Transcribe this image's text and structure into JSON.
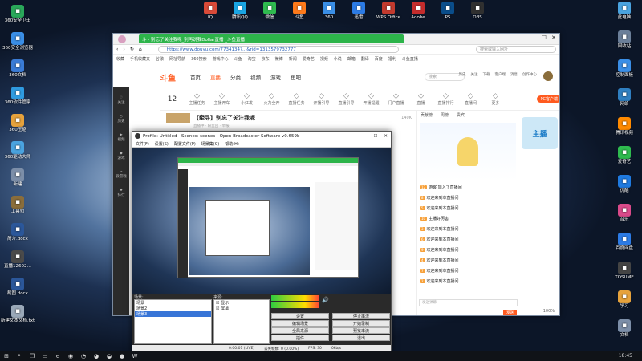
{
  "desktop": {
    "left_icons": [
      {
        "label": "360安全卫士",
        "color": "#2aa85a"
      },
      {
        "label": "360安全浏览器",
        "color": "#3a8ee6"
      },
      {
        "label": "360文档",
        "color": "#3a7bd5"
      },
      {
        "label": "360软件管家",
        "color": "#2f9be0"
      },
      {
        "label": "360压缩",
        "color": "#e6a23c"
      },
      {
        "label": "360驱动大师",
        "color": "#4aa3df"
      },
      {
        "label": "新建",
        "color": "#7c8ea8"
      },
      {
        "label": "工具包",
        "color": "#8a6d3b"
      },
      {
        "label": "简介.docx",
        "color": "#2b579a"
      },
      {
        "label": "直播12602…",
        "color": "#4a4a4a"
      },
      {
        "label": "截图.docx",
        "color": "#2b579a"
      },
      {
        "label": "新建文本文档.txt",
        "color": "#9aa8b8"
      }
    ],
    "top_icons": [
      {
        "label": "IQ",
        "color": "#d94a38"
      },
      {
        "label": "腾讯QQ",
        "color": "#1aa5e3"
      },
      {
        "label": "微信",
        "color": "#2fbb4f"
      },
      {
        "label": "斗鱼",
        "color": "#ff7a1a"
      },
      {
        "label": "360",
        "color": "#3a8ee6"
      },
      {
        "label": "迅雷",
        "color": "#2c7be5"
      },
      {
        "label": "WPS Office",
        "color": "#c23a2e"
      },
      {
        "label": "Adobe",
        "color": "#c42c2c"
      },
      {
        "label": "PS",
        "color": "#0a4d8a"
      },
      {
        "label": "OBS",
        "color": "#303030"
      }
    ],
    "right_icons": [
      {
        "label": "此电脑",
        "color": "#4aa3df"
      },
      {
        "label": "回收站",
        "color": "#6b7f99"
      },
      {
        "label": "控制面板",
        "color": "#3a8ee6"
      },
      {
        "label": "网络",
        "color": "#2f7fc1"
      },
      {
        "label": "腾讯视频",
        "color": "#ff8a00"
      },
      {
        "label": "爱奇艺",
        "color": "#2fbb4f"
      },
      {
        "label": "优酷",
        "color": "#1f7ae0"
      },
      {
        "label": "音乐",
        "color": "#d94a8a"
      },
      {
        "label": "百度网盘",
        "color": "#2c7be5"
      },
      {
        "label": "TOSUME",
        "color": "#444"
      },
      {
        "label": "学习",
        "color": "#e6a23c"
      },
      {
        "label": "文档",
        "color": "#7c8ea8"
      }
    ]
  },
  "browser": {
    "tab_title": "斗 - 别忘了关注我呢_别再说我Dollar直播 _斗鱼直播",
    "url": "https://www.douyu.com/7734134?...&rid=1313579732777",
    "search_placeholder": "搜索或输入网址",
    "bookmarks": [
      "收藏",
      "手机收藏夹",
      "谷歌",
      "网址导航",
      "360搜索",
      "游戏中心",
      "斗鱼",
      "淘宝",
      "京东",
      "微博",
      "新闻",
      "爱奇艺",
      "视频",
      "小说",
      "邮箱",
      "翻译",
      "百度",
      "福利",
      "斗鱼直播"
    ],
    "site": {
      "logo": "斗鱼",
      "nav": [
        "首页",
        "直播",
        "分类",
        "视频",
        "游戏",
        "鱼吧"
      ],
      "search": "搜索",
      "user": [
        "历史",
        "关注",
        "下载",
        "客户端",
        "消息",
        "创作中心"
      ]
    },
    "category_count": "12",
    "categories": [
      "主播任务",
      "主播开车",
      "小红发",
      "火力全开",
      "直播任务",
      "开播引导",
      "直播引导",
      "开播提醒",
      "门户直播",
      "直播",
      "直播排行",
      "直播间",
      "更多"
    ],
    "cta": "PC客户端",
    "stream_title": "【牵寻】别忘了关注我呢",
    "stream_sub": "直播中 · 粉丝团 · 举报",
    "follow_count": "140K",
    "chat_tabs": [
      "贡献榜",
      "周榜",
      "贵宾"
    ],
    "chat_lines": [
      {
        "lvl": "12",
        "text": "游客 加入了直播间"
      },
      {
        "lvl": "8",
        "text": "欢迎来到本直播间"
      },
      {
        "lvl": "5",
        "text": "欢迎来到本直播间"
      },
      {
        "lvl": "10",
        "text": "主播好厉害"
      },
      {
        "lvl": "3",
        "text": "欢迎来到本直播间"
      },
      {
        "lvl": "6",
        "text": "欢迎来到本直播间"
      },
      {
        "lvl": "9",
        "text": "欢迎来到本直播间"
      },
      {
        "lvl": "4",
        "text": "欢迎来到本直播间"
      },
      {
        "lvl": "7",
        "text": "欢迎来到本直播间"
      },
      {
        "lvl": "2",
        "text": "欢迎来到本直播间"
      }
    ],
    "chat_input": "发送弹幕",
    "send": "发送",
    "zoom": "100%"
  },
  "obs": {
    "title": "Profile: Untitled - Scenes: scenes - Open Broadcaster Software v0.659b",
    "menu": [
      "文件(F)",
      "设置(S)",
      "配置文件(P)",
      "场景集(C)",
      "帮助(H)"
    ],
    "scenes_label": "场景:",
    "sources_label": "来源:",
    "scenes": [
      "场景",
      "场景2",
      "场景3"
    ],
    "sources": [
      "显示",
      "屏幕"
    ],
    "buttons": [
      "设置",
      "停止串流",
      "编辑场景",
      "开始录制",
      "全局来源",
      "预览串流",
      "插件",
      "退出"
    ],
    "status": [
      "0:00:01 (LIVE)",
      "丢失帧数: 0 (0.00%)",
      "FPS: 30",
      "0kb/s"
    ]
  },
  "taskbar": {
    "time": "18:45",
    "icons": [
      "start",
      "search",
      "taskview",
      "explorer",
      "edge",
      "360",
      "qq",
      "wechat",
      "douyu",
      "obs",
      "word"
    ]
  }
}
